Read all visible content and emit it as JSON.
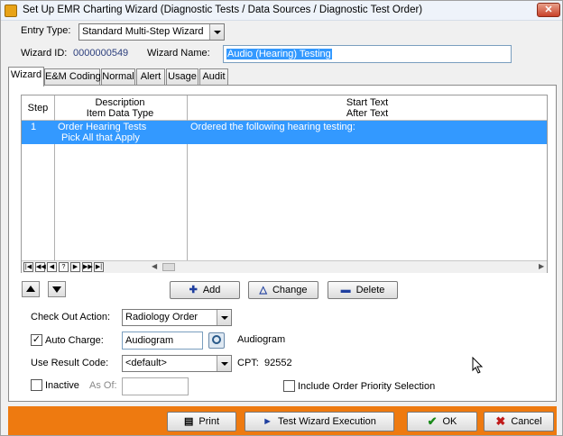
{
  "window": {
    "title": "Set Up EMR Charting Wizard (Diagnostic Tests / Data Sources / Diagnostic Test Order)",
    "close_label": "✕"
  },
  "entry_type": {
    "label": "Entry Type:",
    "value": "Standard Multi-Step Wizard"
  },
  "wizard_id": {
    "label": "Wizard ID:",
    "value": "0000000549"
  },
  "wizard_name": {
    "label": "Wizard Name:",
    "value": "Audio (Hearing) Testing"
  },
  "tabs": [
    {
      "label": "Wizard"
    },
    {
      "label": "E&M Coding"
    },
    {
      "label": "Normal"
    },
    {
      "label": "Alert"
    },
    {
      "label": "Usage"
    },
    {
      "label": "Audit"
    }
  ],
  "grid": {
    "headers": {
      "step": "Step",
      "description": "Description",
      "item_data_type": "Item Data Type",
      "start_text": "Start Text",
      "after_text": "After Text"
    },
    "rows": [
      {
        "step": "1",
        "description": "Order Hearing Tests",
        "item_data_type": "Pick All that Apply",
        "start_text": "Ordered the following hearing testing:"
      }
    ],
    "nav": [
      "|◀",
      "◀◀",
      "◀",
      "?",
      "▶",
      "▶▶",
      "▶|"
    ]
  },
  "actions": {
    "add": "Add",
    "change": "Change",
    "delete": "Delete"
  },
  "checkout_action": {
    "label": "Check Out Action:",
    "value": "Radiology Order"
  },
  "auto_charge": {
    "label": "Auto Charge:",
    "value": "Audiogram",
    "description": "Audiogram",
    "checked": true
  },
  "result_code": {
    "label": "Use Result Code:",
    "value": "<default>",
    "cpt_label": "CPT:",
    "cpt_value": "92552"
  },
  "inactive": {
    "label": "Inactive",
    "as_of_label": "As Of:",
    "as_of_value": ""
  },
  "priority": {
    "label": "Include Order Priority Selection"
  },
  "footer": {
    "print": "Print",
    "test_wizard": "Test Wizard Execution",
    "ok": "OK",
    "cancel": "Cancel"
  },
  "colors": {
    "selection": "#3399ff",
    "footer": "#ee7a10",
    "titlebar": "#eef3fa"
  }
}
